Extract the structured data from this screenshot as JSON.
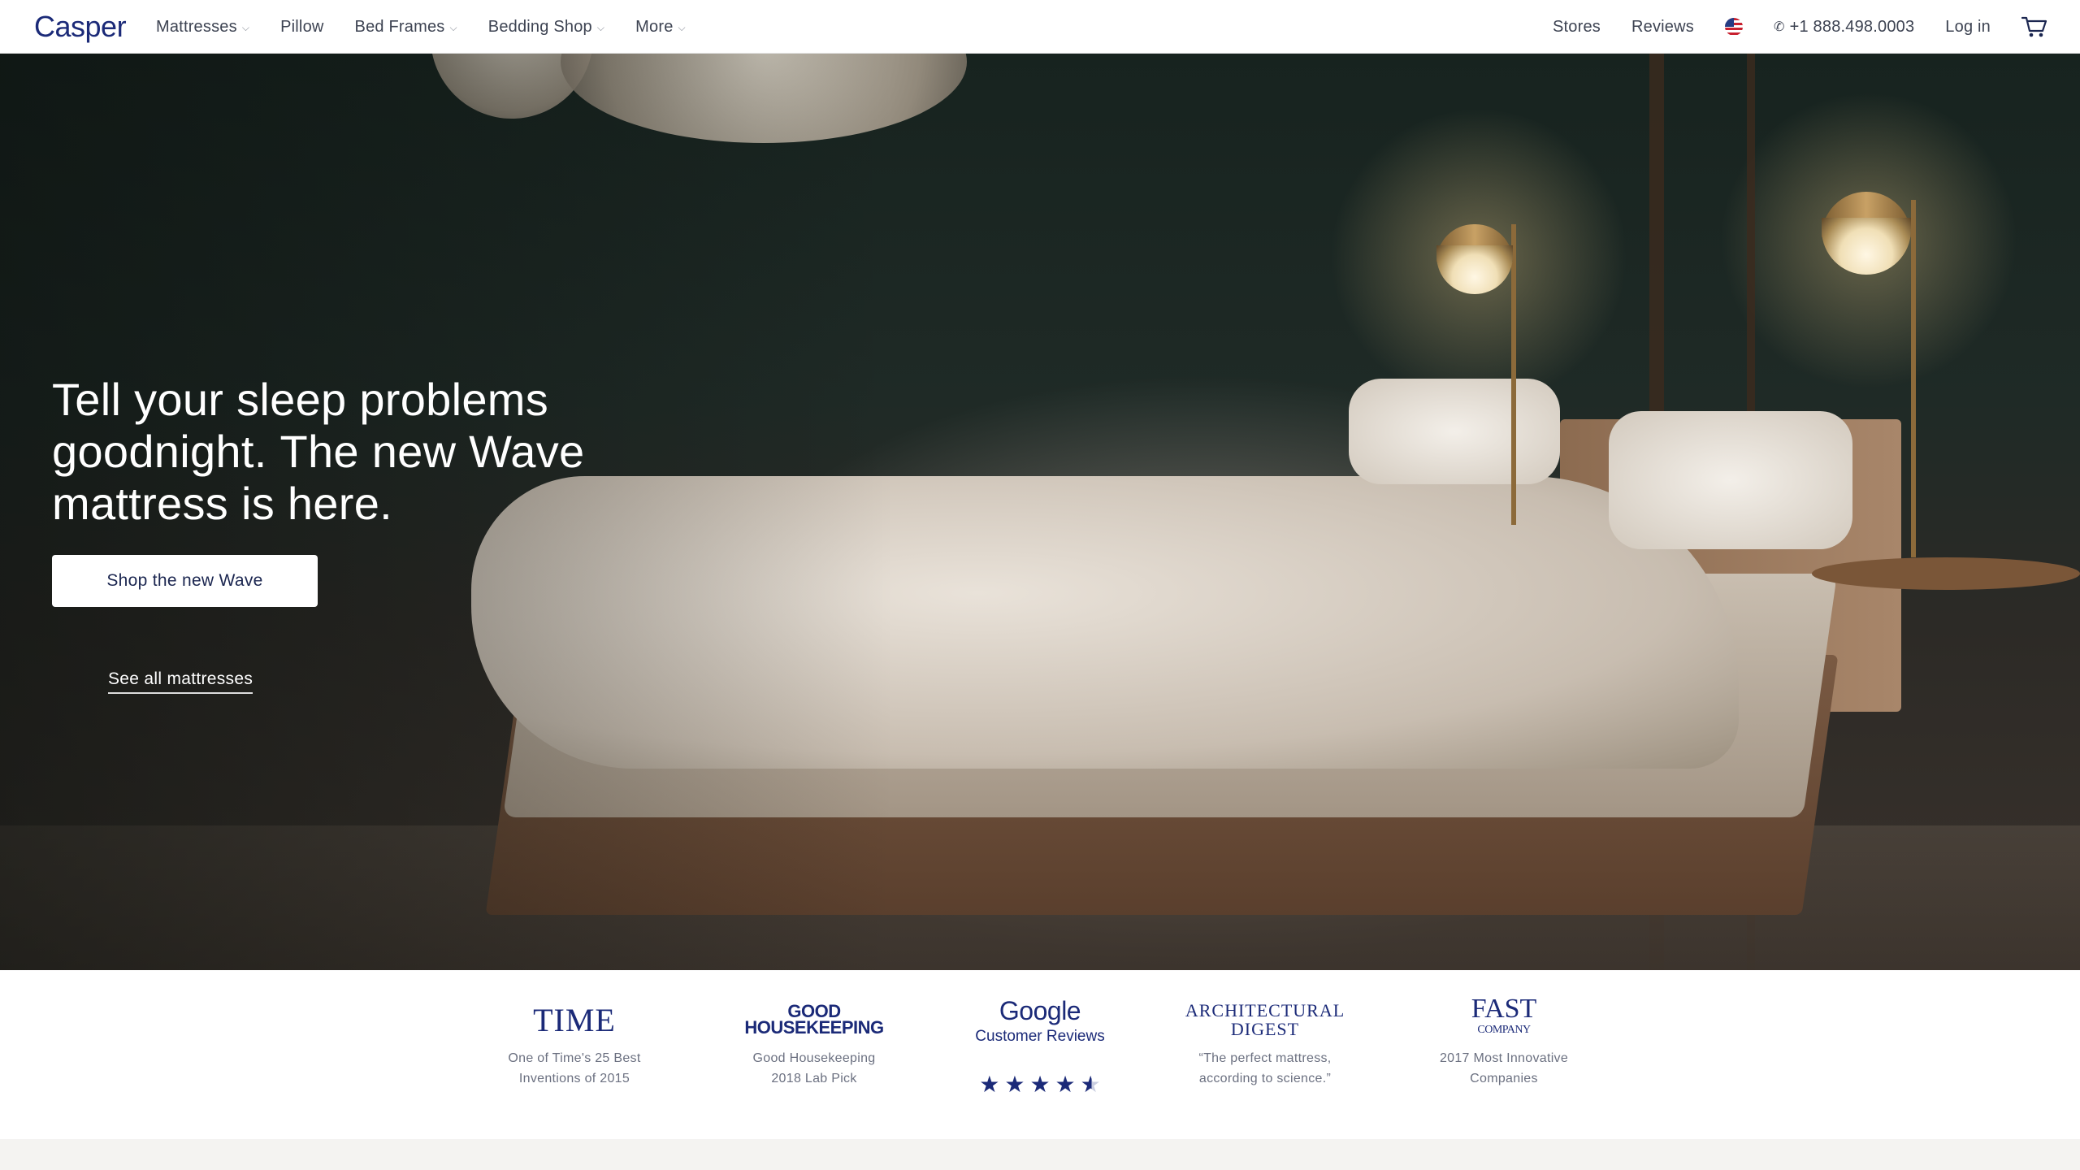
{
  "nav": {
    "logo": "Casper",
    "menu": [
      {
        "label": "Mattresses",
        "dropdown": true
      },
      {
        "label": "Pillow",
        "dropdown": false
      },
      {
        "label": "Bed Frames",
        "dropdown": true
      },
      {
        "label": "Bedding Shop",
        "dropdown": true
      },
      {
        "label": "More",
        "dropdown": true
      }
    ],
    "stores": "Stores",
    "reviews": "Reviews",
    "phone": "+1 888.498.0003",
    "login": "Log in"
  },
  "hero": {
    "headline_light": "Tell your sleep problems goodnight. ",
    "headline_bold": "The new Wave mattress is here.",
    "cta": "Shop the new Wave",
    "link": "See all mattresses"
  },
  "press": [
    {
      "logo": "TIME",
      "caption_1": "One of Time's 25 Best",
      "caption_2": "Inventions of 2015"
    },
    {
      "logo_1": "GOOD",
      "logo_2": "HOUSEKEEPING",
      "caption_1": "Good Housekeeping",
      "caption_2": "2018 Lab Pick"
    },
    {
      "logo_1": "Google",
      "logo_2": "Customer Reviews",
      "stars": "★★★★★",
      "rating": 4.5
    },
    {
      "logo_1": "ARCHITECTURAL",
      "logo_2": "DIGEST",
      "caption_1": "“The perfect mattress,",
      "caption_2": "according to science.”"
    },
    {
      "logo_1": "FAST",
      "logo_2": "COMPANY",
      "caption_1": "2017 Most Innovative",
      "caption_2": "Companies"
    }
  ],
  "colors": {
    "brand": "#1b2a78",
    "text": "#3d4352",
    "caption": "#6b7080"
  }
}
